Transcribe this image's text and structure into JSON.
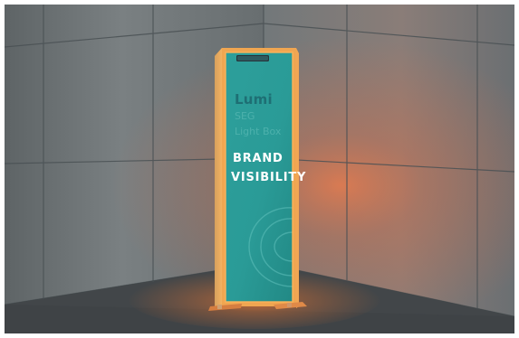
{
  "photo": {
    "subject": "lightbox-display-in-room-corner"
  },
  "lightbox": {
    "brand_name": "Lumi",
    "brand_line_1": "SEG",
    "brand_line_2": "Light Box",
    "headline_line_1": "BRAND",
    "headline_line_2": "VISIBILITY"
  },
  "colors": {
    "panel_teal": "#2a9d99",
    "frame_orange": "#e58a35",
    "brand_dark": "#1e6f74",
    "brand_light": "#58b8b3",
    "room_gray": "#6f7476",
    "floor_gray": "#3f4346",
    "warm_glow": "#ff6a3a"
  }
}
